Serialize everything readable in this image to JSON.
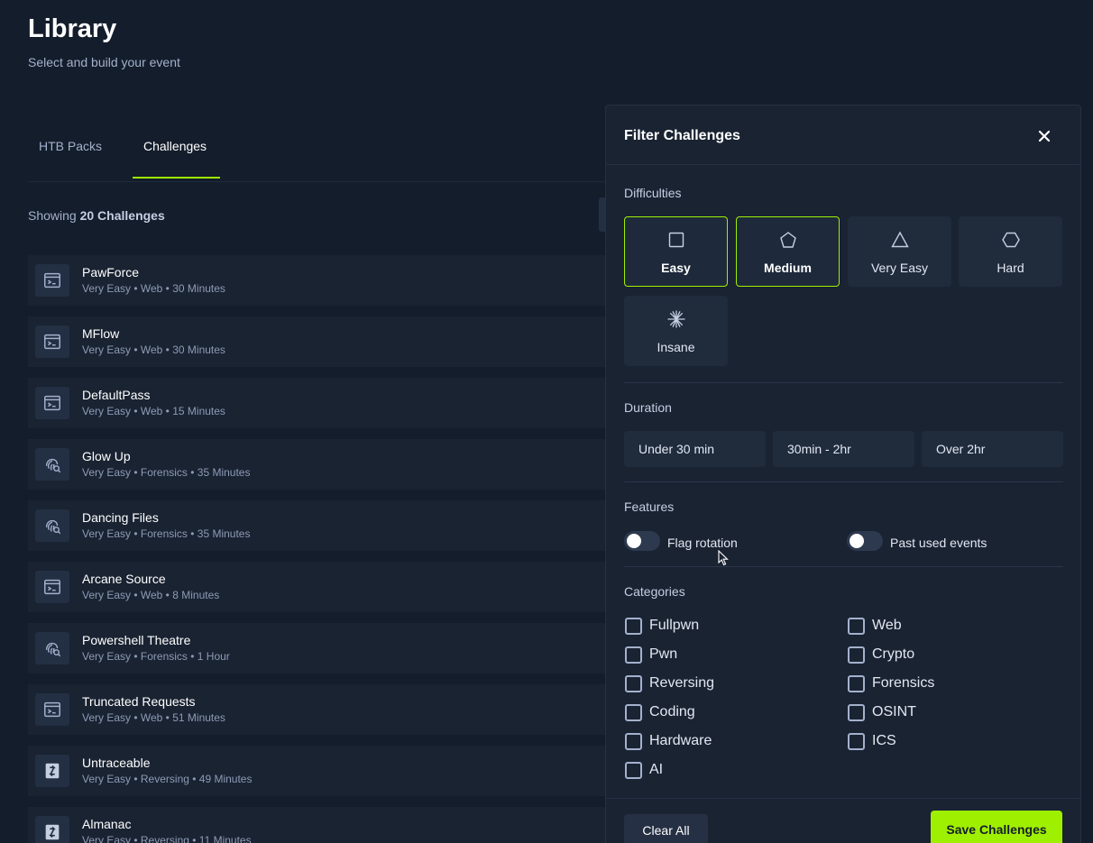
{
  "header": {
    "title": "Library",
    "subtitle": "Select and build your event"
  },
  "tabs": [
    {
      "label": "HTB Packs",
      "active": false
    },
    {
      "label": "Challenges",
      "active": true
    }
  ],
  "showing": {
    "prefix": "Showing",
    "count": "20 Challenges"
  },
  "challenges": [
    {
      "name": "PawForce",
      "meta": "Very Easy • Web • 30 Minutes",
      "icon": "terminal-window-icon"
    },
    {
      "name": "MFlow",
      "meta": "Very Easy • Web • 30 Minutes",
      "icon": "terminal-window-icon"
    },
    {
      "name": "DefaultPass",
      "meta": "Very Easy • Web • 15 Minutes",
      "icon": "terminal-window-icon"
    },
    {
      "name": "Glow Up",
      "meta": "Very Easy • Forensics • 35 Minutes",
      "icon": "fingerprint-search-icon"
    },
    {
      "name": "Dancing Files",
      "meta": "Very Easy • Forensics • 35 Minutes",
      "icon": "fingerprint-search-icon"
    },
    {
      "name": "Arcane Source",
      "meta": "Very Easy • Web • 8 Minutes",
      "icon": "terminal-window-icon"
    },
    {
      "name": "Powershell Theatre",
      "meta": "Very Easy • Forensics • 1 Hour",
      "icon": "fingerprint-search-icon"
    },
    {
      "name": "Truncated Requests",
      "meta": "Very Easy • Web • 51 Minutes",
      "icon": "terminal-window-icon"
    },
    {
      "name": "Untraceable",
      "meta": "Very Easy • Reversing • 49 Minutes",
      "icon": "reversing-arrows-icon"
    },
    {
      "name": "Almanac",
      "meta": "Very Easy • Reversing • 11 Minutes",
      "icon": "reversing-arrows-icon"
    }
  ],
  "filter": {
    "title": "Filter Challenges",
    "difficulties_label": "Difficulties",
    "difficulties": [
      {
        "label": "Easy",
        "selected": true,
        "icon": "square-icon"
      },
      {
        "label": "Medium",
        "selected": true,
        "icon": "pentagon-icon"
      },
      {
        "label": "Very Easy",
        "selected": false,
        "icon": "triangle-icon"
      },
      {
        "label": "Hard",
        "selected": false,
        "icon": "hexagon-icon"
      },
      {
        "label": "Insane",
        "selected": false,
        "icon": "star-burst-icon"
      }
    ],
    "duration_label": "Duration",
    "durations": [
      "Under 30 min",
      "30min - 2hr",
      "Over 2hr"
    ],
    "features_label": "Features",
    "features": [
      {
        "label": "Flag rotation",
        "on": false
      },
      {
        "label": "Past used events",
        "on": false
      }
    ],
    "categories_label": "Categories",
    "categories": [
      {
        "label": "Fullpwn",
        "checked": false
      },
      {
        "label": "Web",
        "checked": false
      },
      {
        "label": "Pwn",
        "checked": false
      },
      {
        "label": "Crypto",
        "checked": false
      },
      {
        "label": "Reversing",
        "checked": false
      },
      {
        "label": "Forensics",
        "checked": false
      },
      {
        "label": "Coding",
        "checked": false
      },
      {
        "label": "OSINT",
        "checked": false
      },
      {
        "label": "Hardware",
        "checked": false
      },
      {
        "label": "ICS",
        "checked": false
      },
      {
        "label": "AI",
        "checked": false
      }
    ],
    "clear_label": "Clear All",
    "save_label": "Save Challenges"
  },
  "colors": {
    "background": "#141d2b",
    "panel": "#1a2332",
    "accent": "#9fef00",
    "muted_text": "#a4b1cd"
  }
}
